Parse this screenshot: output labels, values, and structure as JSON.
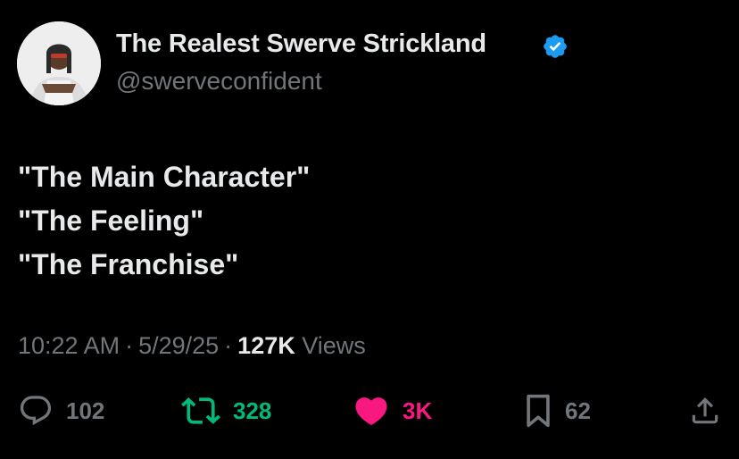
{
  "author": {
    "display_name": "The Realest Swerve Strickland",
    "handle": "@swerveconfident",
    "verified": true,
    "verified_color": "#1d9bf0"
  },
  "tweet": {
    "lines": [
      "\"The Main Character\"",
      "\"The Feeling\"",
      "\"The Franchise\""
    ]
  },
  "meta": {
    "time": "10:22 AM",
    "separator": "·",
    "date": "5/29/25",
    "views_count": "127K",
    "views_label": "Views"
  },
  "actions": {
    "reply": {
      "icon": "reply-icon",
      "count": "102",
      "color": "#71767b"
    },
    "retweet": {
      "icon": "retweet-icon",
      "count": "328",
      "color": "#00ba7c"
    },
    "like": {
      "icon": "heart-icon",
      "count": "3K",
      "color": "#f91880"
    },
    "bookmark": {
      "icon": "bookmark-icon",
      "count": "62",
      "color": "#71767b"
    },
    "share": {
      "icon": "share-icon"
    }
  }
}
